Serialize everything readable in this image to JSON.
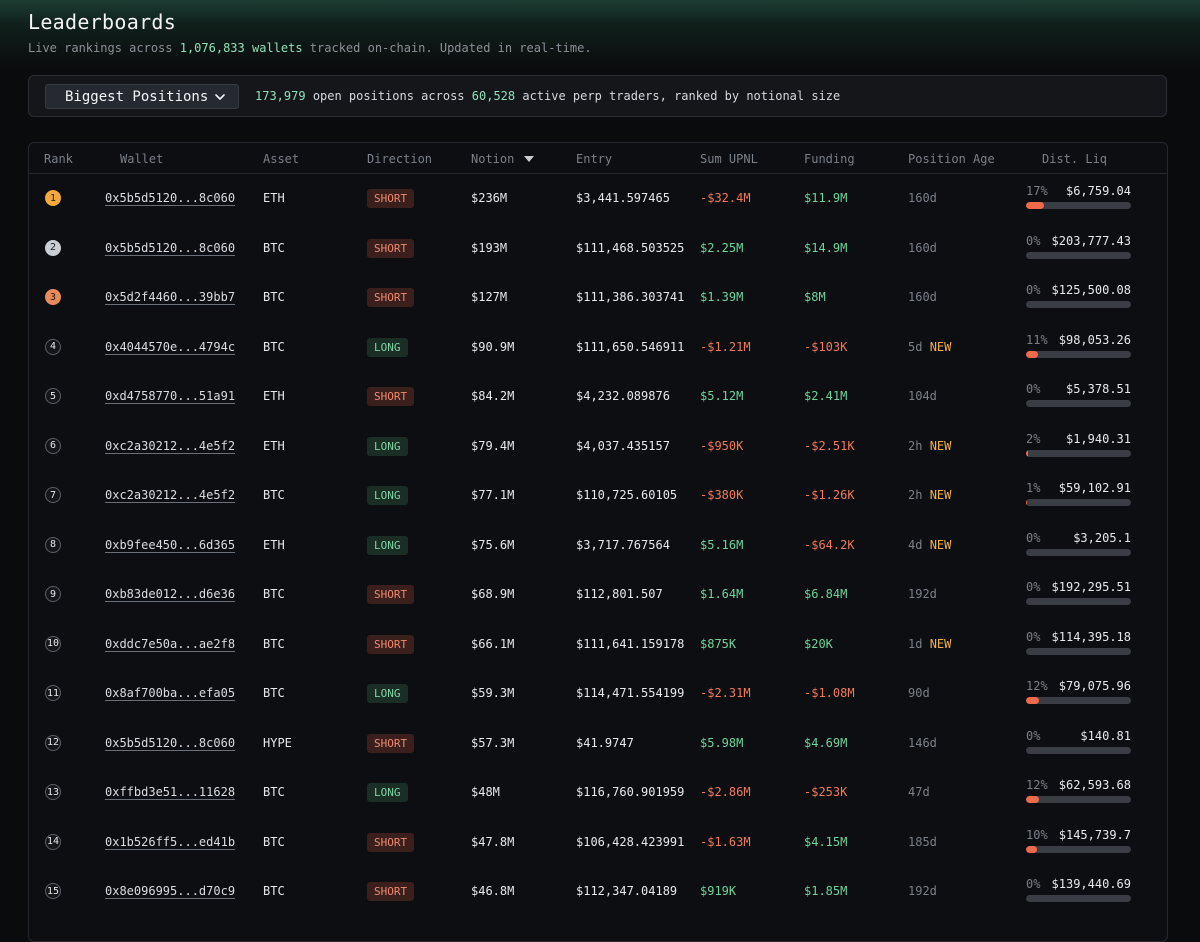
{
  "header": {
    "title": "Leaderboards",
    "subtitle_prefix": "Live rankings across",
    "wallet_count": "1,076,833 wallets",
    "subtitle_suffix": "tracked on-chain. Updated in real-time."
  },
  "filter": {
    "selected": "Biggest Positions",
    "positions_count": "173,979",
    "text_mid": "open positions across",
    "traders_count": "60,528",
    "text_end": "active perp traders, ranked by notional size"
  },
  "columns": {
    "rank": "Rank",
    "wallet": "Wallet",
    "asset": "Asset",
    "direction": "Direction",
    "notional": "Notion",
    "entry": "Entry",
    "upnl": "Sum UPNL",
    "funding": "Funding",
    "age": "Position Age",
    "liq": "Dist. Liq"
  },
  "colors": {
    "accent": "#8fe0b8",
    "short": "#f08a6e",
    "long": "#7fd3a5",
    "negative": "#f07a5a",
    "positive": "#6ed49b",
    "new": "#f0b04a",
    "gold": "#f2a93b",
    "silver": "#c9ced6",
    "bronze": "#e88a5a"
  },
  "rows": [
    {
      "rank": "1",
      "medal": "gold",
      "wallet": "0x5b5d5120...8c060",
      "asset": "ETH",
      "direction": "SHORT",
      "notional": "$236M",
      "entry": "$3,441.597465",
      "upnl": "-$32.4M",
      "upnl_sign": "neg",
      "funding": "$11.9M",
      "funding_sign": "pos",
      "age": "160d",
      "new": "",
      "liq_pct": "17%",
      "liq_frac": 0.17,
      "liq_price": "$6,759.04"
    },
    {
      "rank": "2",
      "medal": "silver",
      "wallet": "0x5b5d5120...8c060",
      "asset": "BTC",
      "direction": "SHORT",
      "notional": "$193M",
      "entry": "$111,468.503525",
      "upnl": "$2.25M",
      "upnl_sign": "pos",
      "funding": "$14.9M",
      "funding_sign": "pos",
      "age": "160d",
      "new": "",
      "liq_pct": "0%",
      "liq_frac": 0,
      "liq_price": "$203,777.43"
    },
    {
      "rank": "3",
      "medal": "bronze",
      "wallet": "0x5d2f4460...39bb7",
      "asset": "BTC",
      "direction": "SHORT",
      "notional": "$127M",
      "entry": "$111,386.303741",
      "upnl": "$1.39M",
      "upnl_sign": "pos",
      "funding": "$8M",
      "funding_sign": "pos",
      "age": "160d",
      "new": "",
      "liq_pct": "0%",
      "liq_frac": 0,
      "liq_price": "$125,500.08"
    },
    {
      "rank": "4",
      "medal": "",
      "wallet": "0x4044570e...4794c",
      "asset": "BTC",
      "direction": "LONG",
      "notional": "$90.9M",
      "entry": "$111,650.546911",
      "upnl": "-$1.21M",
      "upnl_sign": "neg",
      "funding": "-$103K",
      "funding_sign": "neg",
      "age": "5d",
      "new": "NEW",
      "liq_pct": "11%",
      "liq_frac": 0.11,
      "liq_price": "$98,053.26"
    },
    {
      "rank": "5",
      "medal": "",
      "wallet": "0xd4758770...51a91",
      "asset": "ETH",
      "direction": "SHORT",
      "notional": "$84.2M",
      "entry": "$4,232.089876",
      "upnl": "$5.12M",
      "upnl_sign": "pos",
      "funding": "$2.41M",
      "funding_sign": "pos",
      "age": "104d",
      "new": "",
      "liq_pct": "0%",
      "liq_frac": 0,
      "liq_price": "$5,378.51"
    },
    {
      "rank": "6",
      "medal": "",
      "wallet": "0xc2a30212...4e5f2",
      "asset": "ETH",
      "direction": "LONG",
      "notional": "$79.4M",
      "entry": "$4,037.435157",
      "upnl": "-$950K",
      "upnl_sign": "neg",
      "funding": "-$2.51K",
      "funding_sign": "neg",
      "age": "2h",
      "new": "NEW",
      "liq_pct": "2%",
      "liq_frac": 0.02,
      "liq_price": "$1,940.31"
    },
    {
      "rank": "7",
      "medal": "",
      "wallet": "0xc2a30212...4e5f2",
      "asset": "BTC",
      "direction": "LONG",
      "notional": "$77.1M",
      "entry": "$110,725.60105",
      "upnl": "-$380K",
      "upnl_sign": "neg",
      "funding": "-$1.26K",
      "funding_sign": "neg",
      "age": "2h",
      "new": "NEW",
      "liq_pct": "1%",
      "liq_frac": 0.01,
      "liq_price": "$59,102.91"
    },
    {
      "rank": "8",
      "medal": "",
      "wallet": "0xb9fee450...6d365",
      "asset": "ETH",
      "direction": "LONG",
      "notional": "$75.6M",
      "entry": "$3,717.767564",
      "upnl": "$5.16M",
      "upnl_sign": "pos",
      "funding": "-$64.2K",
      "funding_sign": "neg",
      "age": "4d",
      "new": "NEW",
      "liq_pct": "0%",
      "liq_frac": 0,
      "liq_price": "$3,205.1"
    },
    {
      "rank": "9",
      "medal": "",
      "wallet": "0xb83de012...d6e36",
      "asset": "BTC",
      "direction": "SHORT",
      "notional": "$68.9M",
      "entry": "$112,801.507",
      "upnl": "$1.64M",
      "upnl_sign": "pos",
      "funding": "$6.84M",
      "funding_sign": "pos",
      "age": "192d",
      "new": "",
      "liq_pct": "0%",
      "liq_frac": 0,
      "liq_price": "$192,295.51"
    },
    {
      "rank": "10",
      "medal": "",
      "wallet": "0xddc7e50a...ae2f8",
      "asset": "BTC",
      "direction": "SHORT",
      "notional": "$66.1M",
      "entry": "$111,641.159178",
      "upnl": "$875K",
      "upnl_sign": "pos",
      "funding": "$20K",
      "funding_sign": "pos",
      "age": "1d",
      "new": "NEW",
      "liq_pct": "0%",
      "liq_frac": 0,
      "liq_price": "$114,395.18"
    },
    {
      "rank": "11",
      "medal": "",
      "wallet": "0x8af700ba...efa05",
      "asset": "BTC",
      "direction": "LONG",
      "notional": "$59.3M",
      "entry": "$114,471.554199",
      "upnl": "-$2.31M",
      "upnl_sign": "neg",
      "funding": "-$1.08M",
      "funding_sign": "neg",
      "age": "90d",
      "new": "",
      "liq_pct": "12%",
      "liq_frac": 0.12,
      "liq_price": "$79,075.96"
    },
    {
      "rank": "12",
      "medal": "",
      "wallet": "0x5b5d5120...8c060",
      "asset": "HYPE",
      "direction": "SHORT",
      "notional": "$57.3M",
      "entry": "$41.9747",
      "upnl": "$5.98M",
      "upnl_sign": "pos",
      "funding": "$4.69M",
      "funding_sign": "pos",
      "age": "146d",
      "new": "",
      "liq_pct": "0%",
      "liq_frac": 0,
      "liq_price": "$140.81"
    },
    {
      "rank": "13",
      "medal": "",
      "wallet": "0xffbd3e51...11628",
      "asset": "BTC",
      "direction": "LONG",
      "notional": "$48M",
      "entry": "$116,760.901959",
      "upnl": "-$2.86M",
      "upnl_sign": "neg",
      "funding": "-$253K",
      "funding_sign": "neg",
      "age": "47d",
      "new": "",
      "liq_pct": "12%",
      "liq_frac": 0.12,
      "liq_price": "$62,593.68"
    },
    {
      "rank": "14",
      "medal": "",
      "wallet": "0x1b526ff5...ed41b",
      "asset": "BTC",
      "direction": "SHORT",
      "notional": "$47.8M",
      "entry": "$106,428.423991",
      "upnl": "-$1.63M",
      "upnl_sign": "neg",
      "funding": "$4.15M",
      "funding_sign": "pos",
      "age": "185d",
      "new": "",
      "liq_pct": "10%",
      "liq_frac": 0.1,
      "liq_price": "$145,739.7"
    },
    {
      "rank": "15",
      "medal": "",
      "wallet": "0x8e096995...d70c9",
      "asset": "BTC",
      "direction": "SHORT",
      "notional": "$46.8M",
      "entry": "$112,347.04189",
      "upnl": "$919K",
      "upnl_sign": "pos",
      "funding": "$1.85M",
      "funding_sign": "pos",
      "age": "192d",
      "new": "",
      "liq_pct": "0%",
      "liq_frac": 0,
      "liq_price": "$139,440.69"
    }
  ]
}
